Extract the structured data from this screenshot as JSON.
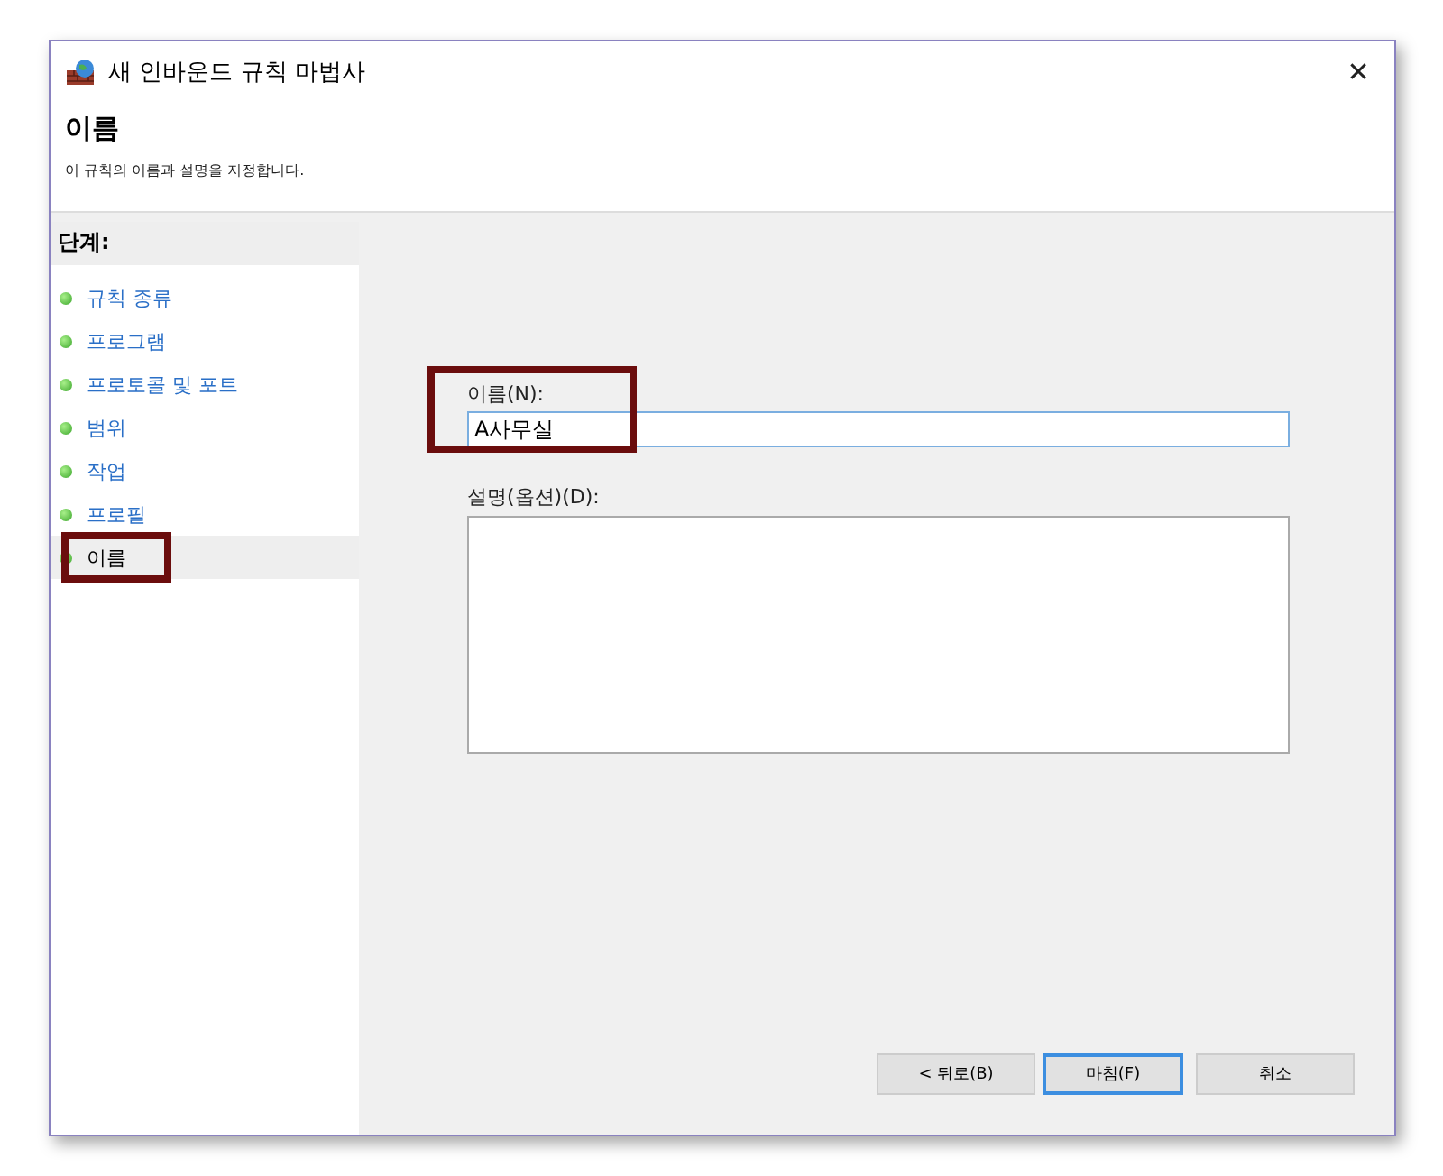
{
  "window": {
    "title": "새 인바운드 규칙 마법사",
    "close": "✕"
  },
  "header": {
    "title": "이름",
    "description": "이 규칙의 이름과 설명을 지정합니다."
  },
  "steps": {
    "title": "단계:",
    "items": [
      {
        "label": "규칙 종류",
        "selected": false,
        "highlighted": false
      },
      {
        "label": "프로그램",
        "selected": false,
        "highlighted": false
      },
      {
        "label": "프로토콜 및 포트",
        "selected": false,
        "highlighted": false
      },
      {
        "label": "범위",
        "selected": false,
        "highlighted": false
      },
      {
        "label": "작업",
        "selected": false,
        "highlighted": false
      },
      {
        "label": "프로필",
        "selected": false,
        "highlighted": false
      },
      {
        "label": "이름",
        "selected": true,
        "highlighted": true
      }
    ]
  },
  "form": {
    "name_label": "이름(N):",
    "name_value": "A사무실",
    "name_highlighted": true,
    "description_label": "설명(옵션)(D):"
  },
  "buttons": [
    {
      "label": "< 뒤로(B)",
      "default": false
    },
    {
      "label": "마침(F)",
      "default": true
    },
    {
      "label": "취소",
      "default": false
    }
  ]
}
